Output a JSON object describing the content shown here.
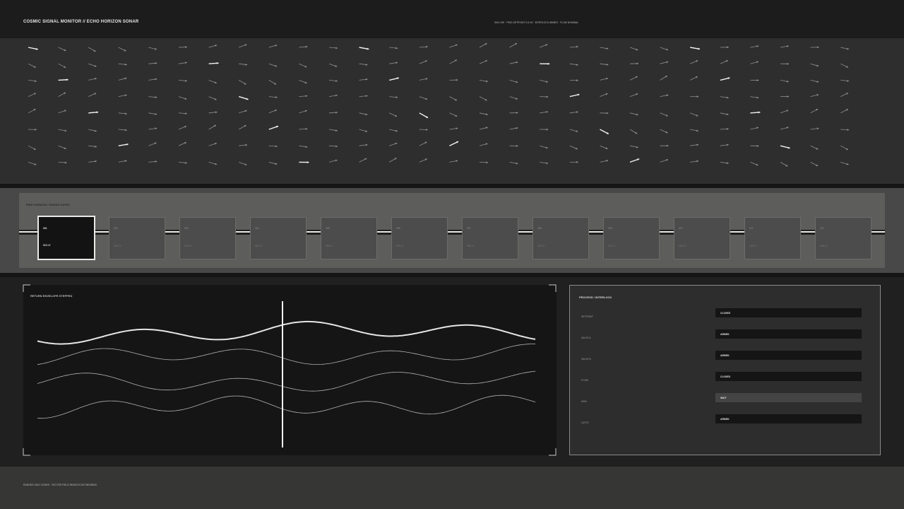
{
  "header": {
    "title": "COSMIC SIGNAL MONITOR // ECHO HORIZON SONAR",
    "status": "SIM LIVE  ·  PING SETPOINT 0.6 HZ  ·  INTERLOCK ARMED  ·  FLOW NOMINAL"
  },
  "vector_field": {
    "arrow_color": "#8f908e",
    "highlight_color": "#f2f3f1"
  },
  "ping_strip": {
    "label": "PING HORIZON / RANGE GATES",
    "cards": [
      {
        "id": "001",
        "range": "013 LY",
        "active": true
      },
      {
        "id": "002",
        "range": "026 LY",
        "active": false
      },
      {
        "id": "003",
        "range": "039 LY",
        "active": false
      },
      {
        "id": "004",
        "range": "052 LY",
        "active": false
      },
      {
        "id": "005",
        "range": "065 LY",
        "active": false
      },
      {
        "id": "006",
        "range": "078 LY",
        "active": false
      },
      {
        "id": "007",
        "range": "091 LY",
        "active": false
      },
      {
        "id": "008",
        "range": "104 LY",
        "active": false
      },
      {
        "id": "009",
        "range": "117 LY",
        "active": false
      },
      {
        "id": "010",
        "range": "130 LY",
        "active": false
      },
      {
        "id": "011",
        "range": "143 LY",
        "active": false
      },
      {
        "id": "012",
        "range": "156 LY",
        "active": false
      }
    ]
  },
  "envelope": {
    "label": "RETURN ENVELOPE  STEPPED"
  },
  "interlock": {
    "title": "PROCESS / INTERLOCK",
    "rows": [
      {
        "label": "SETPOINT",
        "value": "CLOSED",
        "highlight": false
      },
      {
        "label": "VALVE A",
        "value": "ARMED",
        "highlight": false
      },
      {
        "label": "VALVE B",
        "value": "ARMED",
        "highlight": false
      },
      {
        "label": "FLOW",
        "value": "CLOSED",
        "highlight": false
      },
      {
        "label": "ARM",
        "value": "WAIT",
        "highlight": true
      },
      {
        "label": "LATCH",
        "value": "ARMED",
        "highlight": false
      }
    ]
  },
  "footer": {
    "text": "RANGED ONLY ZONES  ·  VECTOR FIELD READS ECHO BEARING"
  }
}
